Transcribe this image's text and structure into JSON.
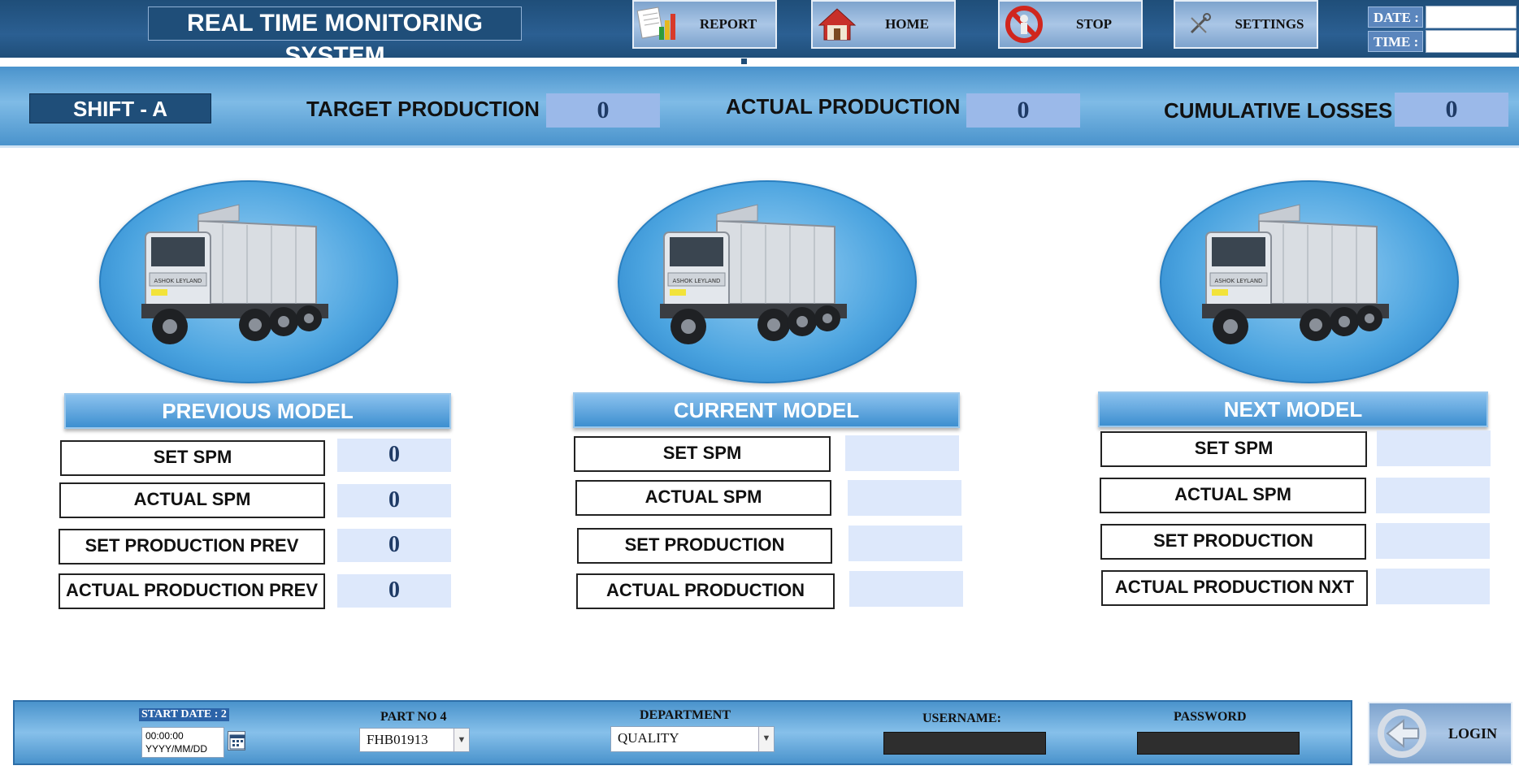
{
  "header": {
    "title": "REAL TIME MONITORING SYSTEM",
    "buttons": {
      "report": "REPORT",
      "home": "HOME",
      "stop": "STOP",
      "settings": "SETTINGS"
    },
    "date_label": "DATE :",
    "time_label": "TIME :",
    "date_value": "",
    "time_value": ""
  },
  "banner": {
    "shift": "SHIFT -  A",
    "target_label": "TARGET PRODUCTION :",
    "target_value": "0",
    "actual_label": "ACTUAL PRODUCTION :",
    "actual_value": "0",
    "losses_label": "CUMULATIVE  LOSSES :",
    "losses_value": "0"
  },
  "models": {
    "previous": {
      "title": "PREVIOUS MODEL",
      "rows": [
        {
          "label": "SET SPM",
          "value": "0"
        },
        {
          "label": "ACTUAL SPM",
          "value": "0"
        },
        {
          "label": "SET PRODUCTION PREV",
          "value": "0"
        },
        {
          "label": "ACTUAL PRODUCTION PREV",
          "value": "0"
        }
      ]
    },
    "current": {
      "title": "CURRENT MODEL",
      "rows": [
        {
          "label": "SET SPM",
          "value": ""
        },
        {
          "label": "ACTUAL SPM",
          "value": ""
        },
        {
          "label": "SET PRODUCTION",
          "value": ""
        },
        {
          "label": "ACTUAL PRODUCTION",
          "value": ""
        }
      ]
    },
    "next": {
      "title": "NEXT MODEL",
      "rows": [
        {
          "label": "SET SPM",
          "value": ""
        },
        {
          "label": "ACTUAL SPM",
          "value": ""
        },
        {
          "label": "SET PRODUCTION",
          "value": ""
        },
        {
          "label": "ACTUAL PRODUCTION NXT",
          "value": ""
        }
      ]
    }
  },
  "truck_branding": "ASHOK LEYLAND",
  "footer": {
    "start_date_label": "START DATE : 2",
    "start_date_time": "00:00:00",
    "start_date_placeholder": "YYYY/MM/DD",
    "part_no_label": "PART NO 4",
    "part_no_value": "FHB01913",
    "department_label": "DEPARTMENT",
    "department_value": "QUALITY",
    "username_label": "USERNAME:",
    "password_label": "PASSWORD",
    "login_label": "LOGIN"
  },
  "colors": {
    "header_bg": "#1f4e79",
    "banner_bg": "#4a93cc",
    "value_bg": "#9bb9e9",
    "field_bg": "#dde8fb"
  }
}
